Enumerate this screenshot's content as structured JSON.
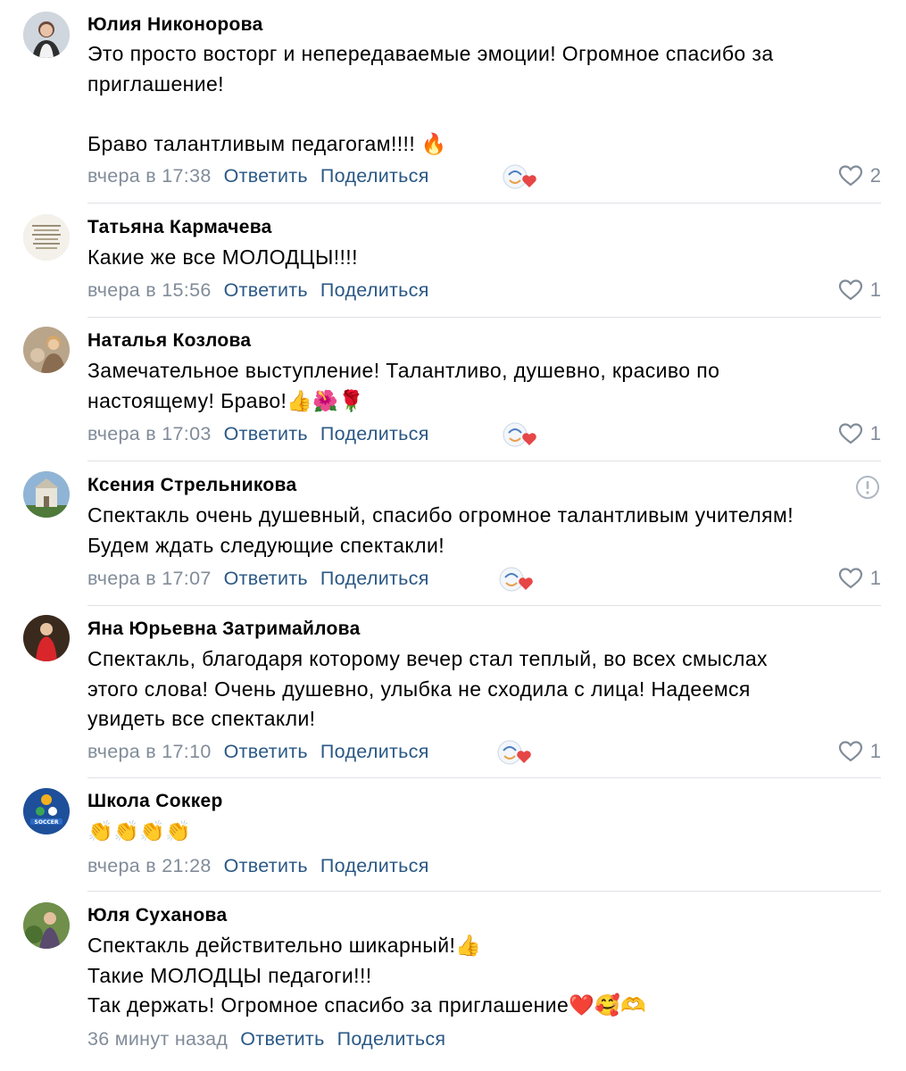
{
  "comments": [
    {
      "author": "Юлия Никонорова",
      "lines": [
        "Это просто восторг и непередаваемые эмоции! Огромное спасибо за",
        "приглашение!",
        "",
        "Браво талантливым педагогам!!!! 🔥"
      ],
      "time": "вчера в 17:38",
      "reply": "Ответить",
      "share": "Поделиться",
      "likes": "2"
    },
    {
      "author": "Татьяна Кармачева",
      "lines": [
        "Какие же все МОЛОДЦЫ!!!!"
      ],
      "time": "вчера в 15:56",
      "reply": "Ответить",
      "share": "Поделиться",
      "likes": "1"
    },
    {
      "author": "Наталья Козлова",
      "lines": [
        "Замечательное выступление! Талантливо, душевно, красиво по",
        "настоящему! Браво!👍🌺🌹"
      ],
      "time": "вчера в 17:03",
      "reply": "Ответить",
      "share": "Поделиться",
      "likes": "1"
    },
    {
      "author": "Ксения Стрельникова",
      "lines": [
        "Спектакль очень душевный, спасибо огромное талантливым учителям!",
        "Будем ждать следующие спектакли!"
      ],
      "time": "вчера в 17:07",
      "reply": "Ответить",
      "share": "Поделиться",
      "likes": "1"
    },
    {
      "author": "Яна Юрьевна Затримайлова",
      "lines": [
        "Спектакль, благодаря которому вечер стал теплый, во всех смыслах",
        "этого слова! Очень душевно, улыбка не сходила с лица! Надеемся",
        "увидеть все спектакли!"
      ],
      "time": "вчера в 17:10",
      "reply": "Ответить",
      "share": "Поделиться",
      "likes": "1"
    },
    {
      "author": "Школа Соккер",
      "lines": [
        "👏👏👏👏"
      ],
      "time": "вчера в 21:28",
      "reply": "Ответить",
      "share": "Поделиться",
      "likes": ""
    },
    {
      "author": "Юля Суханова",
      "lines": [
        "Спектакль действительно шикарный!👍",
        "Такие МОЛОДЦЫ педагоги!!!",
        "Так держать! Огромное спасибо за приглашение❤️🥰🫶"
      ],
      "time": "36 минут назад",
      "reply": "Ответить",
      "share": "Поделиться",
      "likes": ""
    }
  ],
  "school_logo_text": "SOCCER",
  "colors": {
    "link": "#2a5885",
    "meta": "#818c99",
    "divider": "#dfe1e5",
    "heart_red": "#e64646"
  },
  "icons": {
    "like": "heart-outline-icon",
    "reaction": "author-reaction-heart-icon",
    "report": "exclamation-circle-icon"
  }
}
